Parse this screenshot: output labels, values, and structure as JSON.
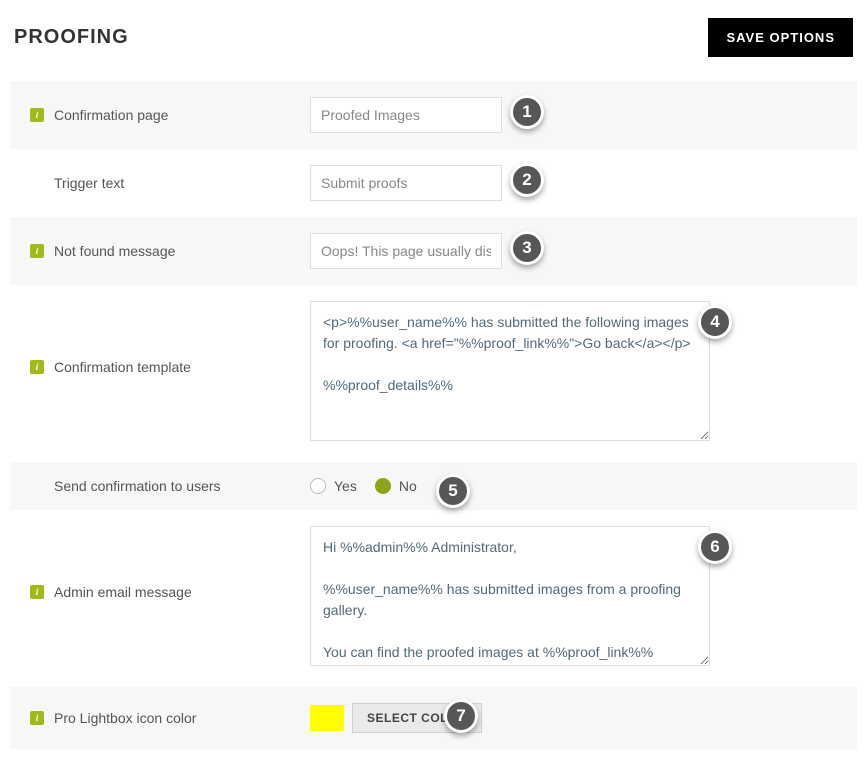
{
  "header": {
    "title": "PROOFING",
    "save_button": "SAVE OPTIONS"
  },
  "rows": {
    "confirmation_page": {
      "label": "Confirmation page",
      "value": "Proofed Images",
      "step": "1"
    },
    "trigger_text": {
      "label": "Trigger text",
      "value": "Submit proofs",
      "step": "2"
    },
    "not_found": {
      "label": "Not found message",
      "value": "Oops! This page usually displa",
      "step": "3"
    },
    "confirmation_template": {
      "label": "Confirmation template",
      "value": "<p>%%user_name%% has submitted the following images for proofing. <a href=\"%%proof_link%%\">Go back</a></p>\n\n%%proof_details%%",
      "step": "4"
    },
    "send_confirmation": {
      "label": "Send confirmation to users",
      "yes": "Yes",
      "no": "No",
      "selected": "no",
      "step": "5"
    },
    "admin_email": {
      "label": "Admin email message",
      "value": "Hi %%admin%% Administrator,\n\n%%user_name%% has submitted images from a proofing gallery.\n\nYou can find the proofed images at %%proof_link%%",
      "step": "6"
    },
    "lightbox_color": {
      "label": "Pro Lightbox icon color",
      "swatch": "#ffff00",
      "button": "SELECT COLOR",
      "step": "7"
    }
  }
}
